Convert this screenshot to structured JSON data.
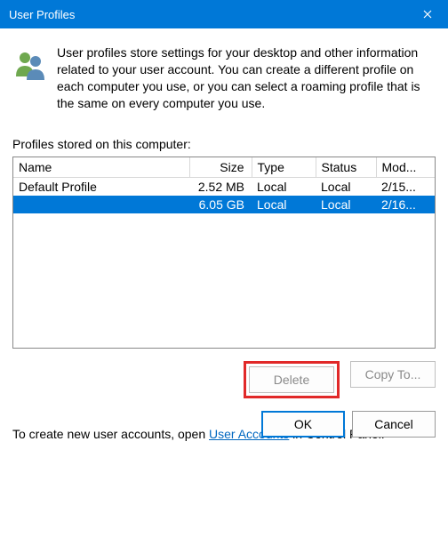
{
  "titlebar": {
    "title": "User Profiles"
  },
  "intro": {
    "description": "User profiles store settings for your desktop and other information related to your user account. You can create a different profile on each computer you use, or you can select a roaming profile that is the same on every computer you use."
  },
  "stored_label": "Profiles stored on this computer:",
  "table": {
    "headers": {
      "name": "Name",
      "size": "Size",
      "type": "Type",
      "status": "Status",
      "modified": "Mod..."
    },
    "rows": [
      {
        "name": "Default Profile",
        "size": "2.52 MB",
        "type": "Local",
        "status": "Local",
        "modified": "2/15...",
        "selected": false
      },
      {
        "name": "",
        "size": "6.05 GB",
        "type": "Local",
        "status": "Local",
        "modified": "2/16...",
        "selected": true
      }
    ]
  },
  "profile_buttons": {
    "delete": "Delete",
    "copy_to": "Copy To..."
  },
  "bottom": {
    "prefix": "To create new user accounts, open ",
    "link": "User Accounts",
    "suffix": " in Control Panel."
  },
  "dialog_buttons": {
    "ok": "OK",
    "cancel": "Cancel"
  }
}
